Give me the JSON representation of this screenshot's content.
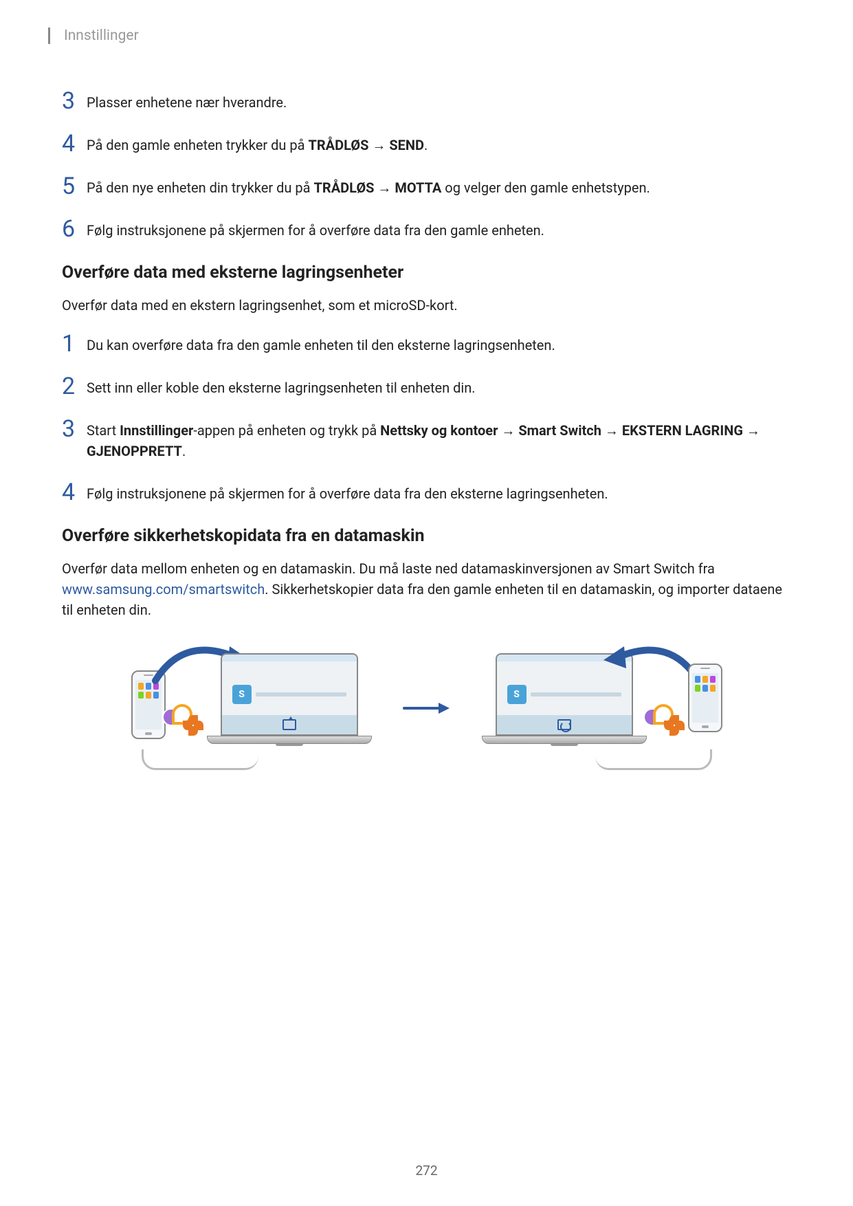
{
  "header": {
    "title": "Innstillinger"
  },
  "setA": {
    "s3": {
      "num": "3",
      "text": "Plasser enhetene nær hverandre."
    },
    "s4": {
      "num": "4",
      "pre": "På den gamle enheten trykker du på ",
      "b1": "TRÅDLØS",
      "arr": " → ",
      "b2": "SEND",
      "post": "."
    },
    "s5": {
      "num": "5",
      "pre": "På den nye enheten din trykker du på ",
      "b1": "TRÅDLØS",
      "arr": " → ",
      "b2": "MOTTA",
      "post": " og velger den gamle enhetstypen."
    },
    "s6": {
      "num": "6",
      "text": "Følg instruksjonene på skjermen for å overføre data fra den gamle enheten."
    }
  },
  "sectionB": {
    "title": "Overføre data med eksterne lagringsenheter",
    "intro": "Overfør data med en ekstern lagringsenhet, som et microSD-kort.",
    "s1": {
      "num": "1",
      "text": "Du kan overføre data fra den gamle enheten til den eksterne lagringsenheten."
    },
    "s2": {
      "num": "2",
      "text": "Sett inn eller koble den eksterne lagringsenheten til enheten din."
    },
    "s3": {
      "num": "3",
      "pre": "Start ",
      "b1": "Innstillinger",
      "mid1": "-appen på enheten og trykk på ",
      "b2": "Nettsky og kontoer",
      "arr1": " → ",
      "b3": "Smart Switch",
      "arr2": " → ",
      "b4": "EKSTERN LAGRING",
      "arr3": " → ",
      "b5": "GJENOPPRETT",
      "post": "."
    },
    "s4": {
      "num": "4",
      "text": "Følg instruksjonene på skjermen for å overføre data fra den eksterne lagringsenheten."
    }
  },
  "sectionC": {
    "title": "Overføre sikkerhetskopidata fra en datamaskin",
    "intro_pre": "Overfør data mellom enheten og en datamaskin. Du må laste ned datamaskinversjonen av Smart Switch fra ",
    "link_text": "www.samsung.com/smartswitch",
    "intro_post": ". Sikkerhetskopier data fra den gamle enheten til en datamaskin, og importer dataene til enheten din."
  },
  "illus": {
    "s_badge": "S"
  },
  "pageNumber": "272"
}
